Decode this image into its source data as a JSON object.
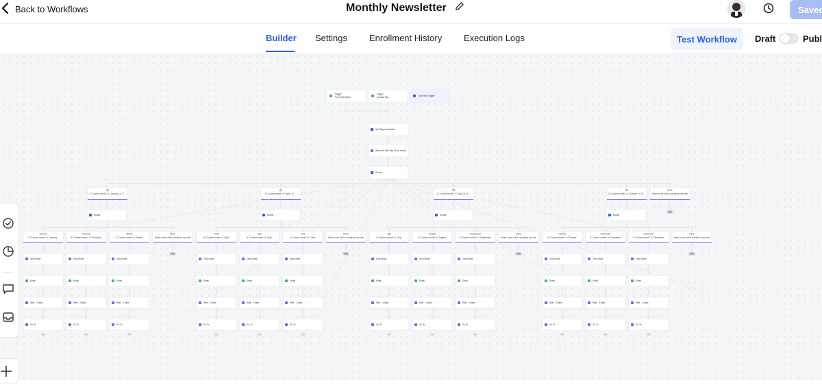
{
  "header": {
    "back_label": "Back to Workflows",
    "title": "Monthly Newsletter",
    "saved_label": "Saved"
  },
  "tabs": [
    {
      "label": "Builder",
      "active": true
    },
    {
      "label": "Settings",
      "active": false
    },
    {
      "label": "Enrollment History",
      "active": false
    },
    {
      "label": "Execution Logs",
      "active": false
    }
  ],
  "actions": {
    "test_label": "Test Workflow",
    "draft_label": "Draft",
    "publish_label": "Publish",
    "published": false
  },
  "colors": {
    "accent": "#2e5ee6",
    "saved_button": "#a9bdf5",
    "canvas_bg": "#f4f5f7"
  },
  "icons": [
    "chevron-left-icon",
    "pencil-icon",
    "history-icon",
    "check-circle-icon",
    "pie-chart-icon",
    "comment-icon",
    "inbox-icon",
    "plus-icon"
  ],
  "workflow": {
    "triggers": [
      {
        "title": "Trigger",
        "subtitle": "Form Submitted"
      },
      {
        "title": "Trigger",
        "subtitle": "Contact Tag"
      },
      {
        "title": "Add New Trigger",
        "subtitle": ""
      }
    ],
    "actions": [
      {
        "label": "Add Tag \"newsletter\""
      },
      {
        "label": "Wait until 15th day of the month"
      },
      {
        "label": "Router"
      }
    ],
    "branches": [
      {
        "label": "Q1",
        "condition": "If \"Current month\" is \"January\" or \"F..."
      },
      {
        "label": "Q2",
        "condition": "If \"Current month\" is \"April\" or \"..."
      },
      {
        "label": "Q3",
        "condition": "If \"Current month\" is \"July\" or \"A..."
      },
      {
        "label": "Q4",
        "condition": "If \"Current month\" is \"October\" or \"N..."
      },
      {
        "label": "None",
        "condition": "When none of the conditions are met"
      }
    ],
    "router_label": "Router",
    "months": [
      {
        "label": "January",
        "condition": "If \"Current month\" is \"January\""
      },
      {
        "label": "February",
        "condition": "If \"Current month\" is \"February\""
      },
      {
        "label": "March",
        "condition": "If \"Current month\" is \"March\""
      },
      {
        "label": "April",
        "condition": "If \"Current month\" is \"April\""
      },
      {
        "label": "May",
        "condition": "If \"Current month\" is \"May\""
      },
      {
        "label": "June",
        "condition": "If \"Current month\" is \"June\""
      },
      {
        "label": "July",
        "condition": "If \"Current month\" is \"July\""
      },
      {
        "label": "August",
        "condition": "If \"Current month\" is \"August\""
      },
      {
        "label": "September",
        "condition": "If \"Current month\" is \"September\""
      },
      {
        "label": "October",
        "condition": "If \"Current month\" is \"October\""
      },
      {
        "label": "November",
        "condition": "If \"Current month\" is \"November\""
      },
      {
        "label": "December",
        "condition": "If \"Current month\" is \"December\""
      }
    ],
    "none_label": "None",
    "none_condition": "When none of the conditions are met",
    "end_label": "END",
    "month_steps": [
      "Only Mode",
      "Email",
      "Wait - 3 days",
      "Go To"
    ]
  }
}
